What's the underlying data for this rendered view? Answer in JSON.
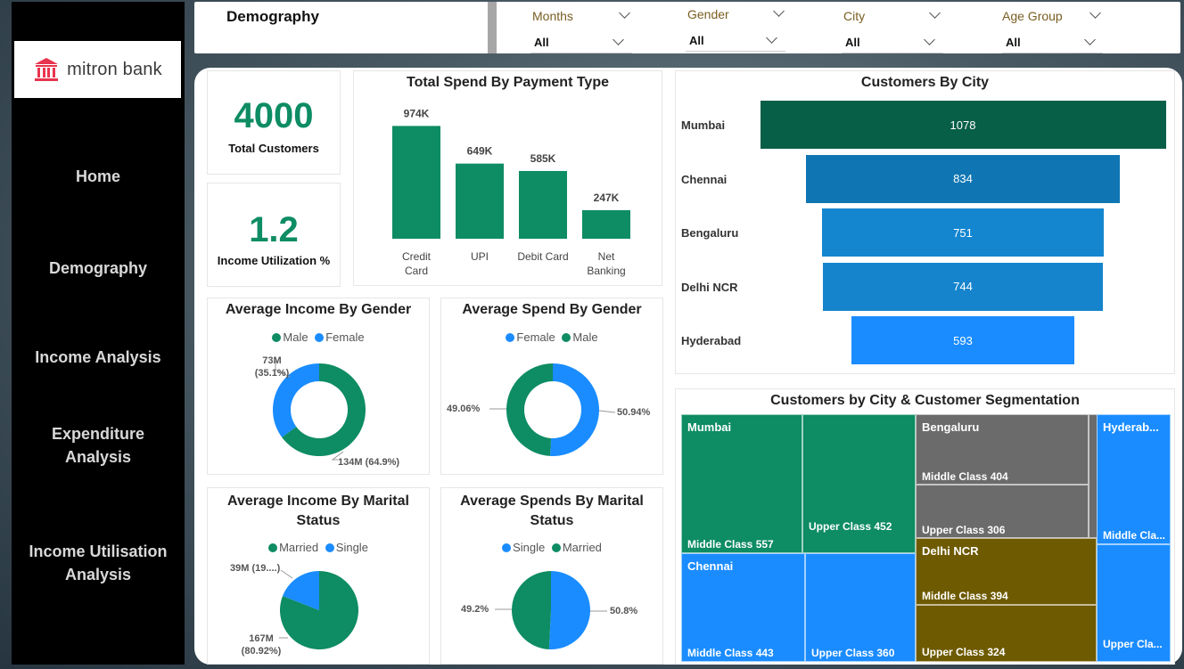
{
  "brand": {
    "name": "mitron bank",
    "color": "#e8344e"
  },
  "nav": [
    "Home",
    "Demography",
    "Income Analysis",
    "Expenditure Analysis",
    "Income Utilisation Analysis"
  ],
  "page_title": "Demography",
  "slicers": [
    {
      "label": "Months",
      "value": "All"
    },
    {
      "label": "Gender",
      "value": "All"
    },
    {
      "label": "City",
      "value": "All"
    },
    {
      "label": "Age Group",
      "value": "All"
    }
  ],
  "kpis": {
    "customers": {
      "value": "4000",
      "label": "Total Customers"
    },
    "utilization": {
      "value": "1.2",
      "label": "Income Utilization %"
    }
  },
  "colors": {
    "green": "#0e8c63",
    "blue": "#1a8cff",
    "dark_green": "#075f47",
    "gray": "#6b6b6b",
    "olive": "#6e5a00"
  },
  "chart_data": [
    {
      "type": "bar",
      "title": "Total Spend By Payment Type",
      "categories": [
        "Credit Card",
        "UPI",
        "Debit Card",
        "Net Banking"
      ],
      "values": [
        974,
        649,
        585,
        247
      ],
      "value_labels": [
        "974K",
        "649K",
        "585K",
        "247K"
      ],
      "ylim": [
        0,
        1000
      ],
      "grid": false
    },
    {
      "type": "bar",
      "title": "Customers By City",
      "categories": [
        "Mumbai",
        "Chennai",
        "Bengaluru",
        "Delhi NCR",
        "Hyderabad"
      ],
      "values": [
        1078,
        834,
        751,
        744,
        593
      ],
      "value_labels": [
        "1078",
        "834",
        "751",
        "744",
        "593"
      ],
      "colors": [
        "#075f47",
        "#0f76b3",
        "#1486cf",
        "#1584cd",
        "#1a8cff"
      ]
    },
    {
      "type": "pie",
      "title": "Average Income By Gender",
      "legend": [
        "Male",
        "Female"
      ],
      "values": [
        64.9,
        35.1
      ],
      "labels": [
        "134M (64.9%)",
        "73M (35.1%)"
      ],
      "colors": [
        "#0e8c63",
        "#1a8cff"
      ]
    },
    {
      "type": "pie",
      "title": "Average Spend By Gender",
      "legend": [
        "Female",
        "Male"
      ],
      "values": [
        50.94,
        49.06
      ],
      "labels": [
        "50.94%",
        "49.06%"
      ],
      "colors": [
        "#1a8cff",
        "#0e8c63"
      ]
    },
    {
      "type": "pie",
      "title": "Average Income By Marital Status",
      "legend": [
        "Married",
        "Single"
      ],
      "values": [
        80.92,
        19.08
      ],
      "labels": [
        "167M (80.92%)",
        "39M (19....)"
      ],
      "colors": [
        "#0e8c63",
        "#1a8cff"
      ]
    },
    {
      "type": "pie",
      "title": "Average Spends By Marital Status",
      "legend": [
        "Single",
        "Married"
      ],
      "values": [
        50.8,
        49.2
      ],
      "labels": [
        "50.8%",
        "49.2%"
      ],
      "colors": [
        "#1a8cff",
        "#0e8c63"
      ]
    },
    {
      "type": "treemap",
      "title": "Customers by City & Customer Segmentation",
      "cities": [
        {
          "name": "Mumbai",
          "segments": [
            "Middle Class 557",
            "Upper Class 452"
          ]
        },
        {
          "name": "Chennai",
          "segments": [
            "Middle Class 443",
            "Upper Class 360"
          ]
        },
        {
          "name": "Bengaluru",
          "segments": [
            "Middle Class 404",
            "Upper Class 306"
          ]
        },
        {
          "name": "Delhi NCR",
          "segments": [
            "Middle Class 394",
            "Upper Class 324"
          ]
        },
        {
          "name": "Hyderab...",
          "segments": [
            "Middle Cla...",
            "Upper Cla..."
          ]
        }
      ]
    }
  ]
}
